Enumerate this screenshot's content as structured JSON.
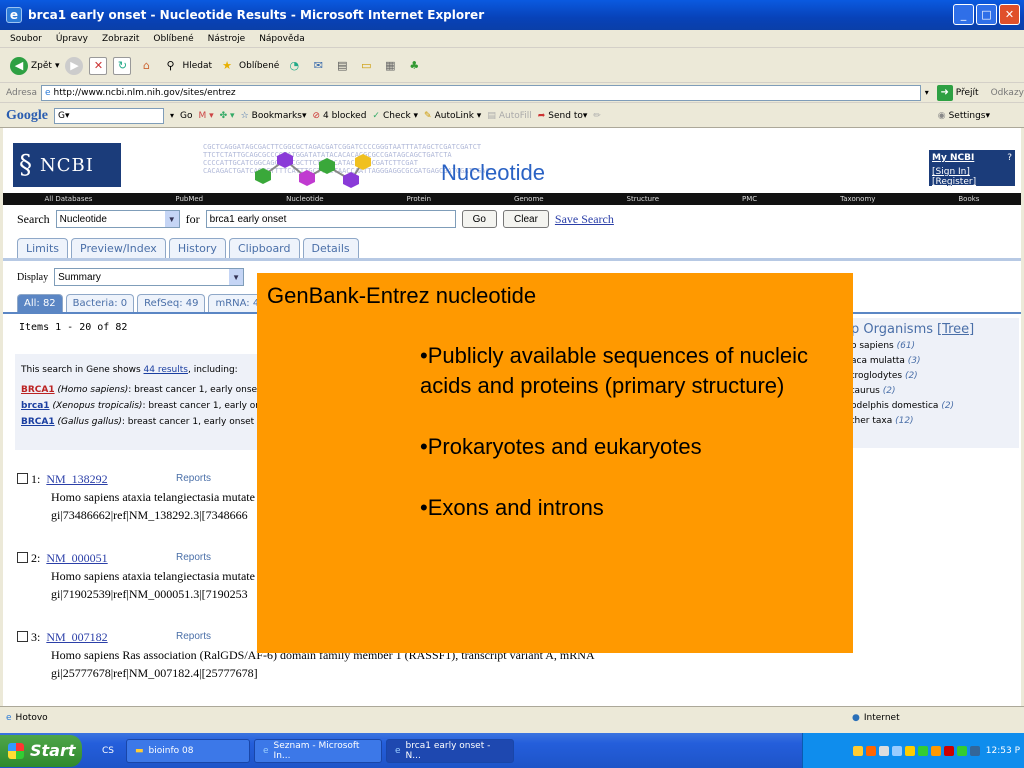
{
  "window": {
    "title": "brca1 early onset - Nucleotide Results - Microsoft Internet Explorer",
    "minimize": "_",
    "maximize": "□",
    "close": "✕"
  },
  "menu": [
    "Soubor",
    "Úpravy",
    "Zobrazit",
    "Oblíbené",
    "Nástroje",
    "Nápověda"
  ],
  "toolbar": {
    "back": "Zpět",
    "search": "Hledat",
    "favorites": "Oblíbené"
  },
  "address": {
    "label": "Adresa",
    "url": "http://www.ncbi.nlm.nih.gov/sites/entrez",
    "go": "Přejít",
    "links": "Odkazy"
  },
  "googlebar": {
    "logo": "Google",
    "g": "G▾",
    "go": "Go",
    "bookmarks": "Bookmarks▾",
    "blocked": "4 blocked",
    "check": "Check ▾",
    "autolink": "AutoLink ▾",
    "autofill": "AutoFill",
    "sendto": "Send to▾",
    "settings": "Settings▾"
  },
  "ncbi": {
    "logo_text": "NCBI",
    "banner_title": "Nucleotide",
    "dna": [
      "CGCTCAGGATAGCGACTTCGGCGCTAGACGATCGGATCCCCGGGTAATTTATAGCTCGATCGATCT",
      "TTCTCTATTGCAGCGCCCGTATGGATATATACACACACGCGCCGATAGCAGCTGATCTA",
      "CCCCATTGCATCGGCAGCTTGCGCTTCTTCGCATACGTCGCGATCTTCGAT",
      "CACAGACTGATCAGCGTTTTCATTTGCTTACTAACCAATTAGGGAGGCGCGATGAGCGATCGATCGAC"
    ],
    "myncbi_title": "My NCBI",
    "myncbi_help": "?",
    "sign_in": "[Sign In]",
    "register": "[Register]",
    "nav": [
      "All Databases",
      "PubMed",
      "Nucleotide",
      "Protein",
      "Genome",
      "Structure",
      "PMC",
      "Taxonomy",
      "Books"
    ]
  },
  "search": {
    "label": "Search",
    "database": "Nucleotide",
    "for": "for",
    "term": "brca1 early onset",
    "go": "Go",
    "clear": "Clear",
    "save": "Save Search"
  },
  "tabs": [
    "Limits",
    "Preview/Index",
    "History",
    "Clipboard",
    "Details"
  ],
  "display": {
    "label": "Display",
    "value": "Summary"
  },
  "filter_tabs": [
    "All: 82",
    "Bacteria: 0",
    "RefSeq: 49",
    "mRNA: 4"
  ],
  "items_text": "Items 1 - 20 of 82",
  "gene_box": {
    "intro_pre": "This search in Gene shows ",
    "intro_link": "44 results",
    "intro_post": ", including:",
    "rows": [
      {
        "gene": "BRCA1",
        "org": "(Homo sapiens)",
        "desc": ": breast cancer 1, early onse"
      },
      {
        "gene": "brca1",
        "org": "(Xenopus tropicalis)",
        "desc": ": breast cancer 1, early or"
      },
      {
        "gene": "BRCA1",
        "org": "(Gallus gallus)",
        "desc": ": breast cancer 1, early onset"
      }
    ]
  },
  "organisms": {
    "title": "p Organisms",
    "tree": "[Tree]",
    "rows": [
      {
        "name": "o sapiens",
        "count": "(61)"
      },
      {
        "name": "aca mulatta",
        "count": "(3)"
      },
      {
        "name": "troglodytes",
        "count": "(2)"
      },
      {
        "name": "taurus",
        "count": "(2)"
      },
      {
        "name": "odelphis domestica",
        "count": "(2)"
      },
      {
        "name": "ther taxa",
        "count": "(12)"
      }
    ]
  },
  "results": [
    {
      "num": "1:",
      "acc": "NM_138292",
      "reports": "Reports",
      "desc": "Homo sapiens ataxia telangiectasia mutate",
      "ids": "gi|73486662|ref|NM_138292.3|[7348666"
    },
    {
      "num": "2:",
      "acc": "NM_000051",
      "reports": "Reports",
      "desc": "Homo sapiens ataxia telangiectasia mutate",
      "ids": "gi|71902539|ref|NM_000051.3|[7190253"
    },
    {
      "num": "3:",
      "acc": "NM_007182",
      "reports": "Reports",
      "desc": "Homo sapiens Ras association (RalGDS/AF-6) domain family member 1 (RASSF1), transcript variant A, mRNA",
      "ids": "gi|25777678|ref|NM_007182.4|[25777678]"
    }
  ],
  "overlay": {
    "heading": "GenBank-Entrez nucleotide",
    "bullets": [
      "•Publicly available sequences of nucleic acids and proteins (primary structure)",
      "•Prokaryotes and eukaryotes",
      "•Exons and introns"
    ],
    "background": "#ff9900"
  },
  "status": {
    "text": "Hotovo",
    "zone": "Internet"
  },
  "taskbar": {
    "start": "Start",
    "quick": "CS",
    "tasks": [
      "bioinfo 08",
      "Seznam - Microsoft In...",
      "brca1 early onset - N..."
    ],
    "clock": "12:53 P"
  }
}
